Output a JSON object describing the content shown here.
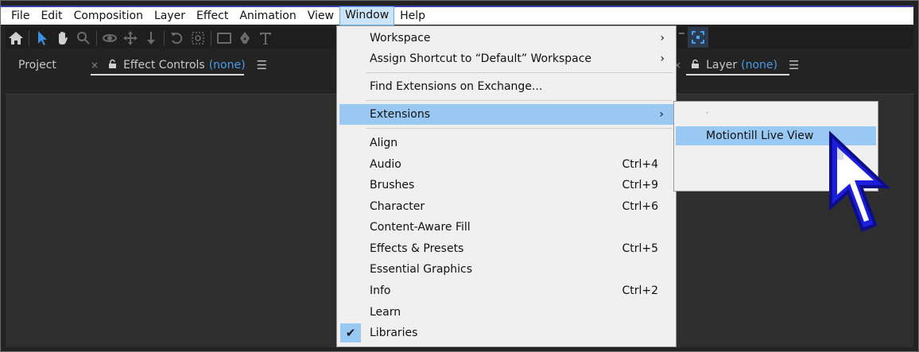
{
  "menubar": {
    "items": [
      "File",
      "Edit",
      "Composition",
      "Layer",
      "Effect",
      "Animation",
      "View",
      "Window",
      "Help"
    ],
    "active": "Window"
  },
  "panels": {
    "project_tab": "Project",
    "effect_controls_tab": "Effect Controls",
    "effect_controls_value": "(none)",
    "layer_tab": "Layer",
    "layer_value": "(none)"
  },
  "window_menu": {
    "workspace": "Workspace",
    "assign_shortcut": "Assign Shortcut to “Default” Workspace",
    "find_extensions": "Find Extensions on Exchange...",
    "extensions": "Extensions",
    "items": [
      {
        "label": "Align",
        "shortcut": ""
      },
      {
        "label": "Audio",
        "shortcut": "Ctrl+4"
      },
      {
        "label": "Brushes",
        "shortcut": "Ctrl+9"
      },
      {
        "label": "Character",
        "shortcut": "Ctrl+6"
      },
      {
        "label": "Content-Aware Fill",
        "shortcut": ""
      },
      {
        "label": "Effects & Presets",
        "shortcut": "Ctrl+5"
      },
      {
        "label": "Essential Graphics",
        "shortcut": ""
      },
      {
        "label": "Info",
        "shortcut": "Ctrl+2"
      },
      {
        "label": "Learn",
        "shortcut": ""
      },
      {
        "label": "Libraries",
        "shortcut": ""
      }
    ],
    "checked_item": "Libraries"
  },
  "extensions_submenu": {
    "items": [
      "Motiontill Live View"
    ]
  },
  "colors": {
    "menu_highlight": "#99c9f2",
    "accent_blue": "#4a9be8",
    "menubar_active": "#cce4f7"
  },
  "icons": [
    "home-icon",
    "selection-tool-icon",
    "hand-tool-icon",
    "zoom-tool-icon",
    "orbit-camera-icon",
    "pan-camera-icon",
    "dolly-camera-icon",
    "rotation-tool-icon",
    "pan-behind-icon",
    "rectangle-tool-icon",
    "pen-tool-icon",
    "type-tool-icon",
    "snapping-icon",
    "lock-icon",
    "close-icon",
    "panel-menu-icon",
    "chevron-right-icon",
    "checkmark-icon",
    "mouse-cursor-icon"
  ]
}
